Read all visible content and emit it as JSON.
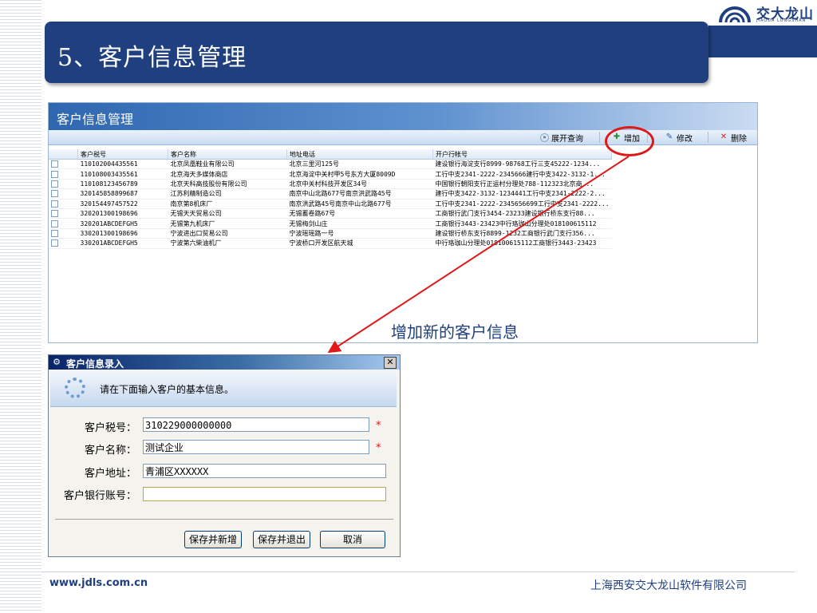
{
  "slide": {
    "title": "5、客户信息管理",
    "logo_text": "交大龙山",
    "logo_sub": "JIAODA LONGSHAN",
    "annotation": "增加新的客户信息",
    "footer_url": "www.jdls.com.cn",
    "footer_company": "上海西安交大龙山软件有限公司",
    "colors": {
      "primary": "#1f3f7f",
      "highlight": "#e01818"
    }
  },
  "panel": {
    "title": "客户信息管理",
    "toolbar": {
      "expand_query": "展开查询",
      "add": "增加",
      "edit": "修改",
      "delete": "删除"
    },
    "columns": [
      "客户税号",
      "客户名称",
      "地址电话",
      "开户行帐号"
    ],
    "rows": [
      [
        "110102004435561",
        "北京凤凰鞋业有限公司",
        "北京三里河125号",
        "建设银行海淀支行8999-98768工行三支45222-1234..."
      ],
      [
        "110108003435561",
        "北京海天多媒体商店",
        "北京海淀中关村甲5号东方大厦8009D",
        "工行中支2341-2222-2345666建行中支3422-3132-1..."
      ],
      [
        "110108123456789",
        "北京天科高技股份有限公司",
        "北京中关村科技开发区34号",
        "中国银行朝阳支行正运村分理处788-112323北京商..."
      ],
      [
        "320145858899687",
        "江苏利精制造公司",
        "南京中山北路677号南京洪武路45号",
        "建行中支3422-3132-1234441工行中支2341-2222-2..."
      ],
      [
        "320154497457522",
        "南京第8机床厂",
        "南京洪武路45号南京中山北路677号",
        "工行中支2341-2222-2345656699工行中支2341-2222..."
      ],
      [
        "320201300198696",
        "无锡天天贸易公司",
        "无锡蓄卷路67号",
        "工商银行武门支行3454-23233建设银行桥东支行88..."
      ],
      [
        "320201ABCDEFGH5",
        "无锡第九机床厂",
        "无锡梅剑山庄",
        "工商银行3443-23423中行珞珈山分理处018100615112"
      ],
      [
        "330201300198696",
        "宁波进出口贸易公司",
        "宁波瑶瑶路一号",
        "建设银行桥东支行8899-1232工商银行武门支行356..."
      ],
      [
        "330201ABCDEFGH5",
        "宁波第六柴油机厂",
        "宁波桥口开发区航天城",
        "中行珞珈山分理处018100615112工商银行3443-23423"
      ]
    ]
  },
  "dialog": {
    "title": "客户信息录入",
    "banner_text": "请在下面输入客户的基本信息。",
    "fields": {
      "tax_label": "客户税号：",
      "tax_value": "310229000000000",
      "name_label": "客户名称：",
      "name_value": "测试企业",
      "address_label": "客户地址：",
      "address_value": "青浦区XXXXXX",
      "bank_label": "客户银行账号：",
      "bank_value": ""
    },
    "required_mark": "*",
    "close_glyph": "✕",
    "buttons": {
      "save_new": "保存并新增",
      "save_exit": "保存并退出",
      "cancel": "取消"
    }
  }
}
